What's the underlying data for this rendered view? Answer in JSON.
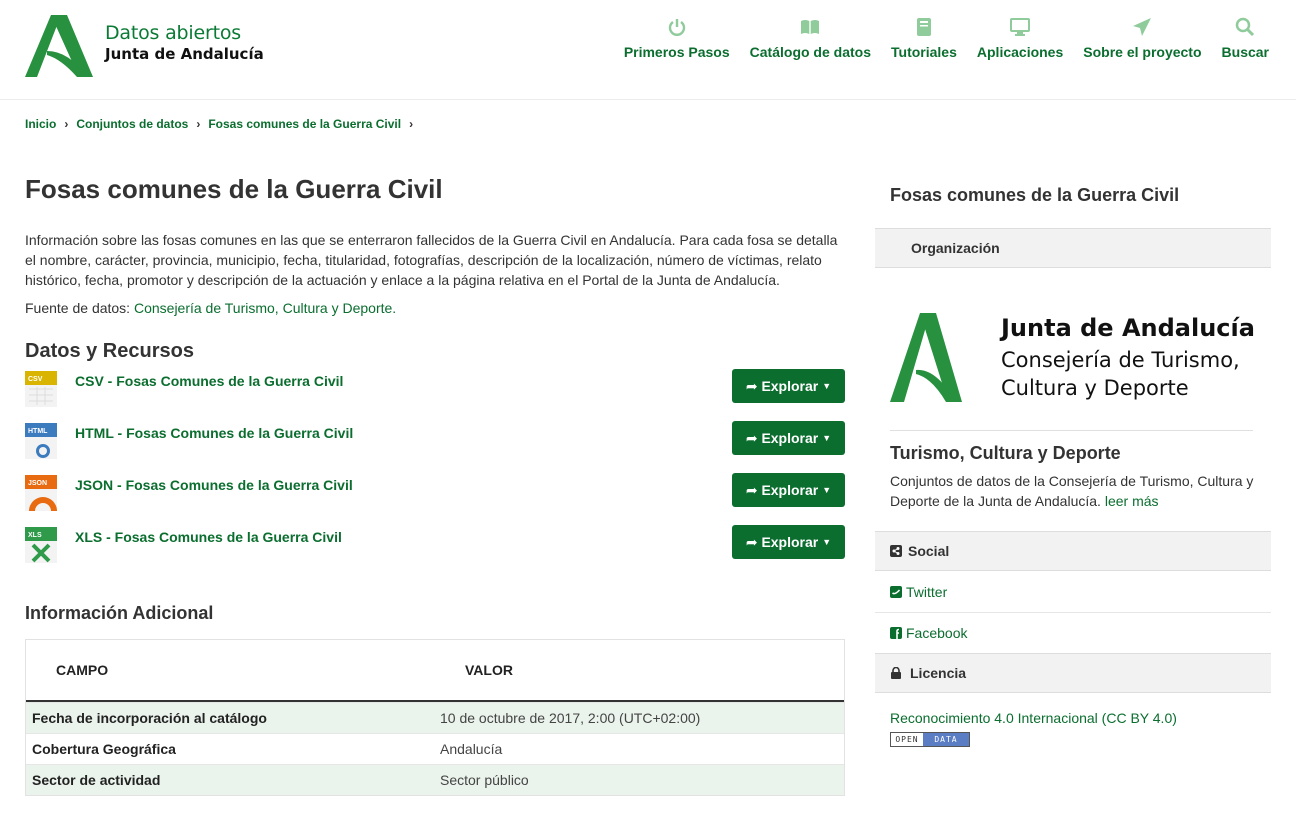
{
  "header": {
    "logo_line1": "Datos abiertos",
    "logo_line2": "Junta de Andalucía",
    "nav": [
      {
        "label": "Primeros Pasos",
        "icon": "power-icon"
      },
      {
        "label": "Catálogo de datos",
        "icon": "book-icon"
      },
      {
        "label": "Tutoriales",
        "icon": "notebook-icon"
      },
      {
        "label": "Aplicaciones",
        "icon": "monitor-icon"
      },
      {
        "label": "Sobre el proyecto",
        "icon": "paper-plane-icon"
      },
      {
        "label": "Buscar",
        "icon": "search-icon"
      }
    ]
  },
  "breadcrumb": [
    "Inicio",
    "Conjuntos de datos",
    "Fosas comunes de la Guerra Civil"
  ],
  "main": {
    "title": "Fosas comunes de la Guerra Civil",
    "description": "Información sobre las fosas comunes en las que se enterraron fallecidos de la Guerra Civil en Andalucía. Para cada fosa se detalla el nombre, carácter, provincia, municipio, fecha, titularidad, fotografías, descripción de la localización, número de víctimas, relato histórico, fecha, promotor y descripción de la actuación y enlace a la página relativa en el Portal de la Junta de Andalucía.",
    "source_label": "Fuente de datos:",
    "source_link": "Consejería de Turismo, Cultura y Deporte.",
    "resources_heading": "Datos y Recursos",
    "explore_label": "Explorar",
    "resources": [
      {
        "format": "CSV",
        "name": "CSV - Fosas Comunes de la Guerra Civil",
        "color": "#d9b400"
      },
      {
        "format": "HTML",
        "name": "HTML - Fosas Comunes de la Guerra Civil",
        "color": "#3d7bbf"
      },
      {
        "format": "JSON",
        "name": "JSON - Fosas Comunes de la Guerra Civil",
        "color": "#e86b12"
      },
      {
        "format": "XLS",
        "name": "XLS - Fosas Comunes de la Guerra Civil",
        "color": "#2e9a4a"
      }
    ],
    "additional_heading": "Información Adicional",
    "table": {
      "headers": [
        "CAMPO",
        "VALOR"
      ],
      "rows": [
        [
          "Fecha de incorporación al catálogo",
          "10 de octubre de 2017, 2:00 (UTC+02:00)"
        ],
        [
          "Cobertura Geográfica",
          "Andalucía"
        ],
        [
          "Sector de actividad",
          "Sector público"
        ]
      ]
    }
  },
  "sidebar": {
    "title": "Fosas comunes de la Guerra Civil",
    "org_heading": "Organización",
    "org_logo_line1": "Junta de Andalucía",
    "org_logo_line2": "Consejería de Turismo,",
    "org_logo_line3": "Cultura y Deporte",
    "org_name": "Turismo, Cultura y Deporte",
    "org_desc": "Conjuntos de datos de la Consejería de Turismo, Cultura y Deporte de la Junta de Andalucía.",
    "read_more": "leer más",
    "social_heading": "Social",
    "twitter": "Twitter",
    "facebook": "Facebook",
    "license_heading": "Licencia",
    "license_link": "Reconocimiento 4.0 Internacional (CC BY 4.0)",
    "badge_left": "OPEN",
    "badge_right": "DATA"
  },
  "colors": {
    "brand_green": "#0b6e2f",
    "logo_green": "#27913f",
    "row_highlight": "#eaf3ec"
  }
}
